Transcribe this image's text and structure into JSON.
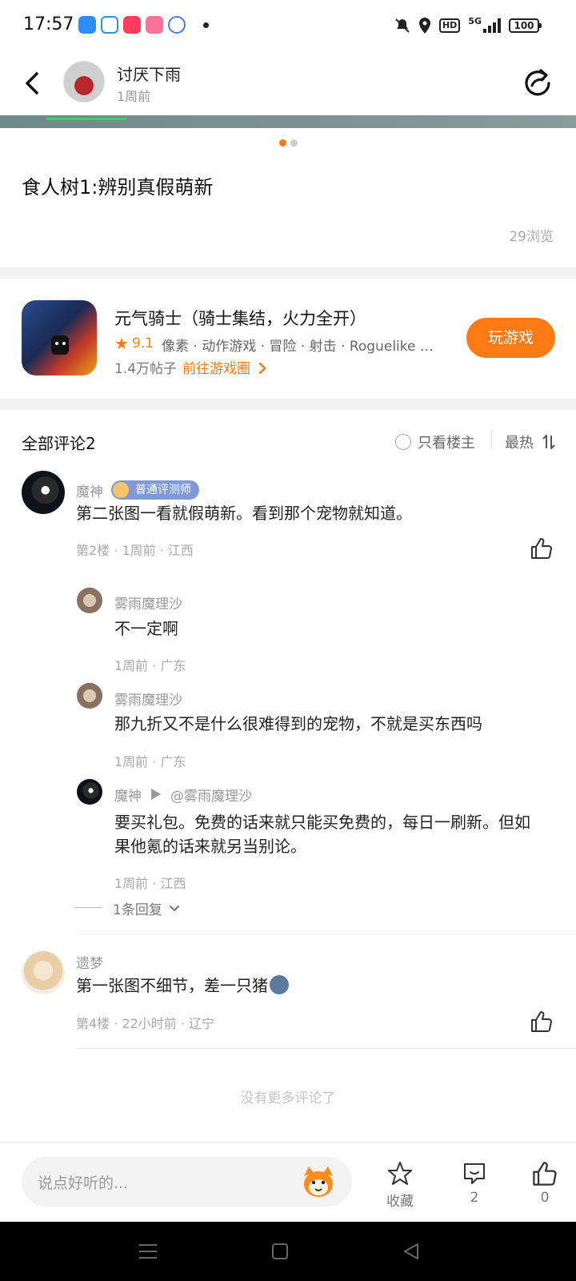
{
  "status_bar": {
    "time": "17:57",
    "hd_label": "HD",
    "network": "5G",
    "battery": "100"
  },
  "header": {
    "author_name": "讨厌下雨",
    "post_time": "1周前"
  },
  "post": {
    "title": "食人树1:辨别真假萌新",
    "views": "29浏览"
  },
  "game_card": {
    "title": "元气骑士（骑士集结，火力全开）",
    "rating": "9.1",
    "tags": "像素 · 动作游戏 · 冒险 · 射击 · Roguelike …",
    "posts": "1.4万帖子",
    "goto_label": "前往游戏圈",
    "play_label": "玩游戏"
  },
  "comments_header": {
    "title": "全部评论2",
    "only_op": "只看楼主",
    "sort_label": "最热"
  },
  "comments": [
    {
      "name": "魔神",
      "badge": "普通评测师",
      "text": "第二张图一看就假萌新。看到那个宠物就知道。",
      "meta": "第2楼 · 1周前 · 江西",
      "replies": [
        {
          "name": "雾雨魔理沙",
          "text": "不一定啊",
          "meta": "1周前 · 广东"
        },
        {
          "name": "雾雨魔理沙",
          "text": "那九折又不是什么很难得到的宠物，不就是买东西吗",
          "meta": "1周前 · 广东"
        },
        {
          "name": "魔神",
          "reply_to": "@雾雨魔理沙",
          "text_line1": "要买礼包。免费的话来就只能买免费的，每日一刷新。但如",
          "text_line2": "果他氪的话来就另当别论。",
          "meta": "1周前 · 江西"
        }
      ],
      "expand_label": "1条回复"
    },
    {
      "name": "遗梦",
      "text": "第一张图不细节，差一只猪",
      "meta": "第4楼 · 22小时前 · 辽宁"
    }
  ],
  "no_more": "没有更多评论了",
  "bottom_bar": {
    "input_placeholder": "说点好听的...",
    "favorite_label": "收藏",
    "comment_count": "2",
    "like_count": "0"
  },
  "colors": {
    "accent": "#ff7a12",
    "badge": "#7f99d9"
  }
}
